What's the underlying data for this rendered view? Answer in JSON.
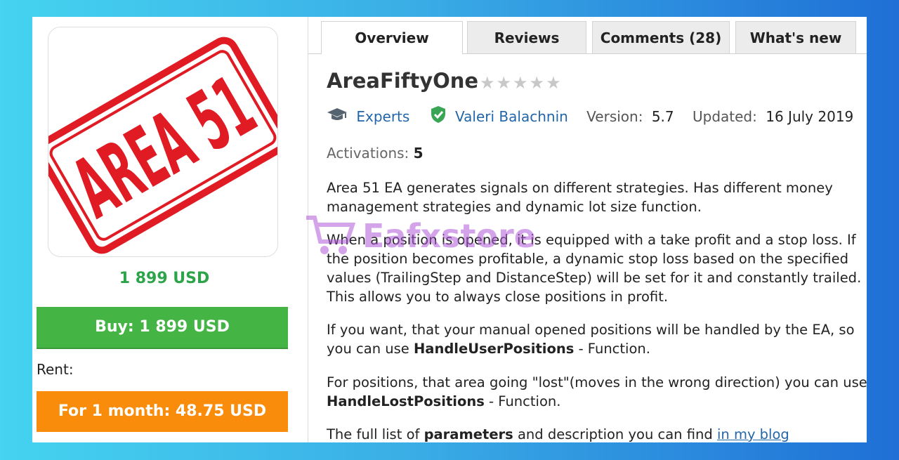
{
  "product": {
    "image_text": "AREA 51",
    "price": "1 899 USD",
    "buy_label": "Buy: 1 899 USD",
    "rent_label": "Rent:",
    "rent_option": "For 1 month: 48.75 USD"
  },
  "tabs": [
    {
      "label": "Overview",
      "active": true
    },
    {
      "label": "Reviews",
      "active": false
    },
    {
      "label": "Comments (28)",
      "active": false
    },
    {
      "label": "What's new",
      "active": false
    }
  ],
  "title": "AreaFiftyOne",
  "rating": {
    "stars_filled": 0,
    "stars_total": 5
  },
  "meta": {
    "category": "Experts",
    "author": "Valeri Balachnin",
    "version_label": "Version:",
    "version_value": "5.7",
    "updated_label": "Updated:",
    "updated_value": "16 July 2019",
    "activations_label": "Activations:",
    "activations_value": "5"
  },
  "description": {
    "p1": "Area 51 EA generates signals on different strategies. Has different money management strategies and dynamic lot size function.",
    "p2": "When a position is opened, it is equipped with a take profit and a stop loss. If the position becomes profitable, a dynamic stop loss based on the specified values (TrailingStep and DistanceStep) will be set for it and constantly trailed. This allows you to always close positions in profit.",
    "p3_before": "If you want, that your manual opened positions will be handled by the EA, so you can use ",
    "p3_bold": "HandleUserPositions",
    "p3_after": " - Function.",
    "p4_before": "For positions, that area going \"lost\"(moves in the wrong direction) you can use ",
    "p4_bold": "HandleLostPositions",
    "p4_after": " - Function.",
    "p5_before": "The full list of ",
    "p5_bold": "parameters",
    "p5_after": " and description you can find ",
    "p5_link": "in my blog"
  },
  "watermark": "Eafxstore",
  "colors": {
    "buy": "#44b444",
    "rent": "#f98c0a",
    "price": "#2ea44a",
    "link": "#2266aa",
    "stamp": "#e01b24"
  }
}
